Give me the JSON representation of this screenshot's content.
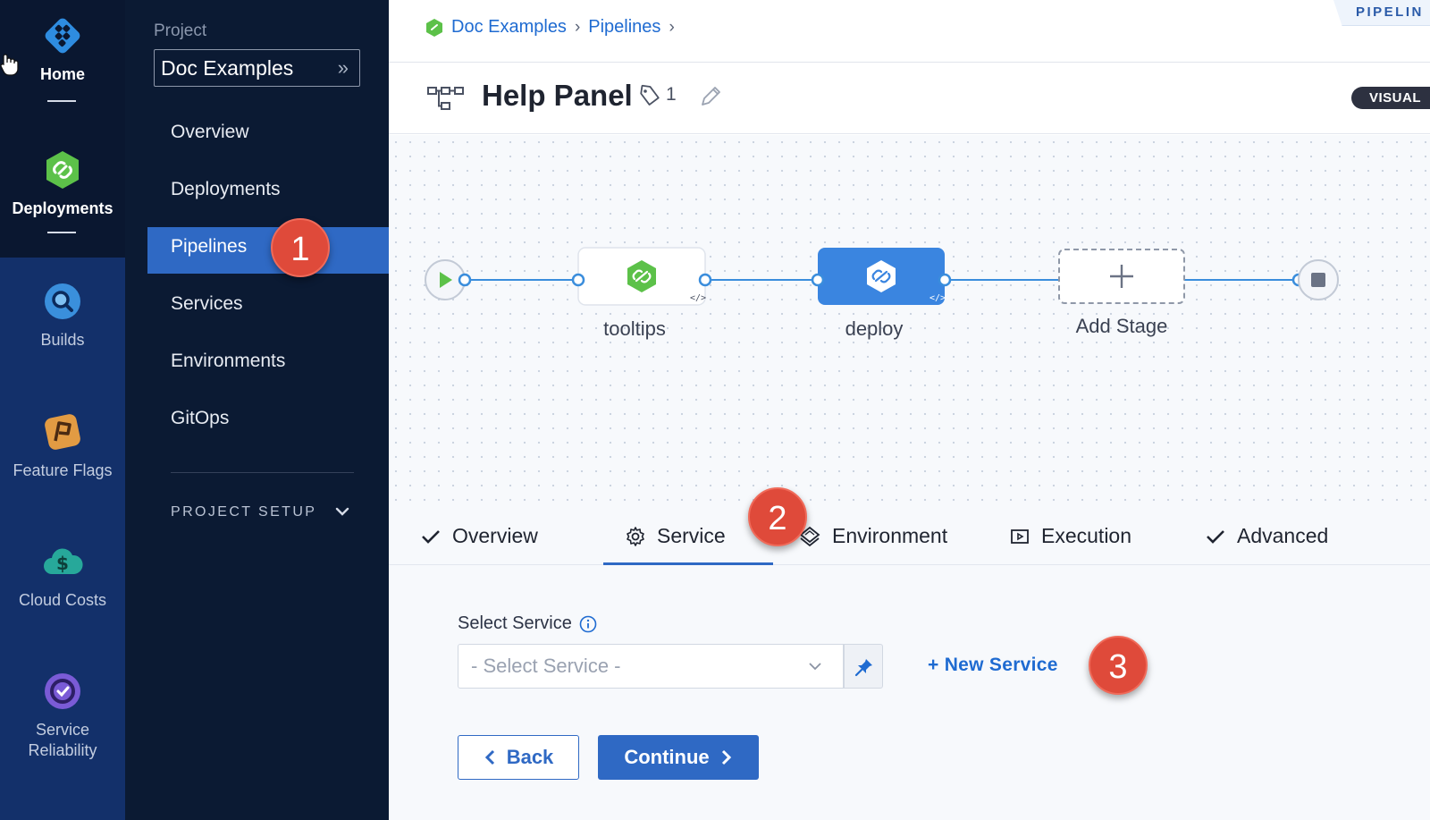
{
  "rail": {
    "items": [
      {
        "label": "Home",
        "icon": "home-diamond-icon"
      },
      {
        "label": "Deployments",
        "icon": "deployments-icon"
      },
      {
        "label": "Builds",
        "icon": "builds-icon"
      },
      {
        "label": "Feature Flags",
        "icon": "feature-flags-icon"
      },
      {
        "label": "Cloud Costs",
        "icon": "cloud-costs-icon"
      },
      {
        "label_line1": "Service",
        "label_line2": "Reliability",
        "icon": "service-reliability-icon"
      }
    ]
  },
  "nav": {
    "project_label": "Project",
    "project_name": "Doc Examples",
    "items": [
      "Overview",
      "Deployments",
      "Pipelines",
      "Services",
      "Environments",
      "GitOps"
    ],
    "active": "Pipelines",
    "setup_label": "PROJECT SETUP"
  },
  "callouts": {
    "one": "1",
    "two": "2",
    "three": "3"
  },
  "header": {
    "breadcrumb": [
      "Doc Examples",
      "Pipelines"
    ],
    "corner_tag": "PIPELIN",
    "title": "Help Panel",
    "tag_count": "1",
    "view_toggle": "VISUAL"
  },
  "pipeline": {
    "stages": [
      {
        "label": "tooltips",
        "state": "default"
      },
      {
        "label": "deploy",
        "state": "selected"
      }
    ],
    "add_stage_label": "Add Stage"
  },
  "tabs": [
    {
      "label": "Overview",
      "icon": "check-icon"
    },
    {
      "label": "Service",
      "icon": "gear-icon",
      "active": true
    },
    {
      "label": "Environment",
      "icon": "layers-icon"
    },
    {
      "label": "Execution",
      "icon": "execution-icon"
    },
    {
      "label": "Advanced",
      "icon": "check-icon"
    }
  ],
  "form": {
    "field_label": "Select Service",
    "select_placeholder": "- Select Service -",
    "new_service": "+ New Service",
    "back": "Back",
    "continue": "Continue"
  },
  "colors": {
    "accent": "#2f69c4",
    "callout": "#df4a3a",
    "rail_dark": "#0b1b3a",
    "rail_light": "#13306a",
    "stage_green": "#5cc149"
  }
}
